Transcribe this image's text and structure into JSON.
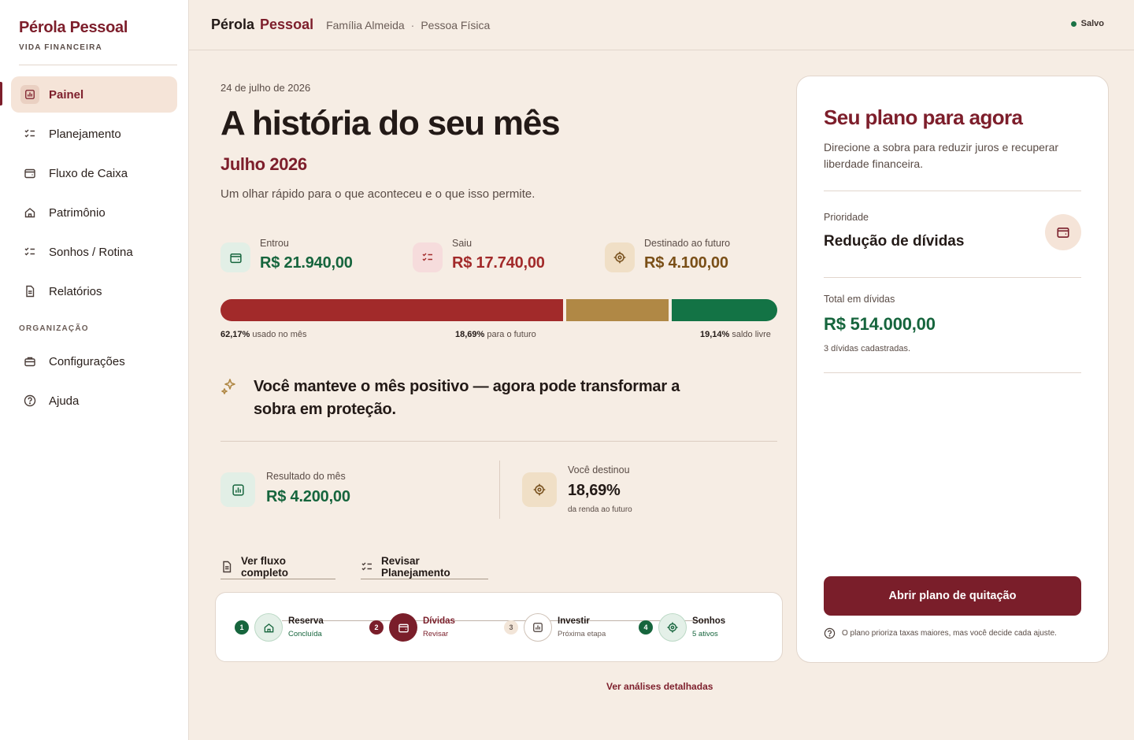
{
  "brand": {
    "name": "Pérola Pessoal",
    "subtitle": "VIDA FINANCEIRA"
  },
  "sidebar": {
    "items": [
      {
        "label": "Painel",
        "icon": "chart-icon",
        "active": true
      },
      {
        "label": "Planejamento",
        "icon": "checklist-icon"
      },
      {
        "label": "Fluxo de Caixa",
        "icon": "wallet-icon"
      },
      {
        "label": "Patrimônio",
        "icon": "home-icon"
      },
      {
        "label": "Sonhos / Rotina",
        "icon": "checklist-icon"
      },
      {
        "label": "Relatórios",
        "icon": "document-icon"
      }
    ],
    "section_label": "ORGANIZAÇÃO",
    "section_items": [
      {
        "label": "Configurações",
        "icon": "briefcase-icon"
      },
      {
        "label": "Ajuda",
        "icon": "help-icon"
      }
    ]
  },
  "topbar": {
    "title_part1": "Pérola",
    "title_part2": "Pessoal",
    "crumb1": "Família Almeida",
    "separator": "·",
    "crumb2": "Pessoa Física",
    "status": "Salvo"
  },
  "main": {
    "date": "24 de julho de 2026",
    "headline": "A história do seu mês",
    "month": "Julho 2026",
    "subtitle": "Um olhar rápido para o que aconteceu e o que isso permite.",
    "stats": [
      {
        "label": "Entrou",
        "value": "R$ 21.940,00",
        "icon": "wallet-icon"
      },
      {
        "label": "Saiu",
        "value": "R$ 17.740,00",
        "icon": "checklist-icon"
      },
      {
        "label": "Destinado ao futuro",
        "value": "R$ 4.100,00",
        "icon": "target-icon"
      }
    ],
    "distribution": [
      {
        "pct": "62,17%",
        "text": "usado no mês",
        "fraction": 0.6217,
        "color": "#a22a2a"
      },
      {
        "pct": "18,69%",
        "text": "para o futuro",
        "fraction": 0.1869,
        "color": "#b08845"
      },
      {
        "pct": "19,14%",
        "text": "saldo livre",
        "fraction": 0.1914,
        "color": "#137345"
      }
    ],
    "insight": "Você manteve o mês positivo — agora pode transformar a sobra em proteção.",
    "result": {
      "label": "Resultado do mês",
      "value": "R$ 4.200,00"
    },
    "destined": {
      "label": "Você destinou",
      "value": "18,69%",
      "note": "da renda ao futuro"
    },
    "actions": {
      "flow": "Ver fluxo completo",
      "planning": "Revisar Planejamento"
    },
    "steps": [
      {
        "num": "1",
        "title": "Reserva",
        "status": "Concluída",
        "icon": "home-icon"
      },
      {
        "num": "2",
        "title": "Dívidas",
        "status": "Revisar",
        "icon": "wallet-icon"
      },
      {
        "num": "3",
        "title": "Investir",
        "status": "Próxima etapa",
        "icon": "chart-icon"
      },
      {
        "num": "4",
        "title": "Sonhos",
        "status": "5 ativos",
        "icon": "target-icon"
      }
    ],
    "more_link": "Ver análises detalhadas"
  },
  "panel": {
    "title": "Seu plano para agora",
    "description": "Direcione a sobra para reduzir juros e recuperar liberdade financeira.",
    "priority_label": "Prioridade",
    "priority_value": "Redução de dívidas",
    "total_label": "Total em dívidas",
    "total_value": "R$ 514.000,00",
    "count_note": "3 dívidas cadastradas.",
    "cta": "Abrir plano de quitação",
    "footnote": "O plano prioriza taxas maiores, mas você decide cada ajuste."
  },
  "colors": {
    "brand": "#7d1e2b",
    "positive": "#16653d",
    "gold": "#8a5a1e",
    "background": "#f6ede4"
  }
}
